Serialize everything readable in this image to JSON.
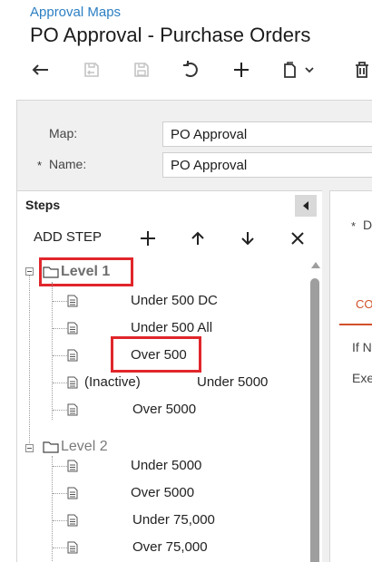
{
  "header": {
    "breadcrumb": "Approval Maps",
    "title": "PO Approval - Purchase Orders"
  },
  "toolbar": {
    "buttons": [
      "undo-icon",
      "save-close-icon",
      "save-icon",
      "refresh-icon",
      "add-icon",
      "copy-paste-icon",
      "delete-icon"
    ]
  },
  "form": {
    "map_label": "Map:",
    "map_value": "PO Approval",
    "name_required": "*",
    "name_label": "Name:",
    "name_value": "PO Approval"
  },
  "steps": {
    "title": "Steps",
    "add_step_label": "ADD STEP",
    "actions": [
      "plus-icon",
      "arrow-up-icon",
      "arrow-down-icon",
      "close-icon"
    ],
    "tree": [
      {
        "label": "Level 1",
        "highlighted": true,
        "children": [
          {
            "text": "Under 500 DC"
          },
          {
            "text": "Under 500 All"
          },
          {
            "text": "Over 500",
            "highlighted": true
          },
          {
            "prefix": "(Inactive)",
            "text": "Under 5000"
          },
          {
            "text": "Over 5000"
          }
        ]
      },
      {
        "label": "Level 2",
        "children": [
          {
            "text": "Under 5000"
          },
          {
            "text": "Over 5000"
          },
          {
            "text": "Under 75,000"
          },
          {
            "text": "Over 75,000"
          }
        ]
      }
    ]
  },
  "right_panel": {
    "required_mark": "*",
    "field_label_partial": "D",
    "tab_partial": "CO",
    "line1_partial": "If N",
    "line2_partial": "Exe"
  },
  "colors": {
    "link": "#2c7fc4",
    "accent_tab": "#d1512a",
    "highlight": "#e0262b"
  }
}
